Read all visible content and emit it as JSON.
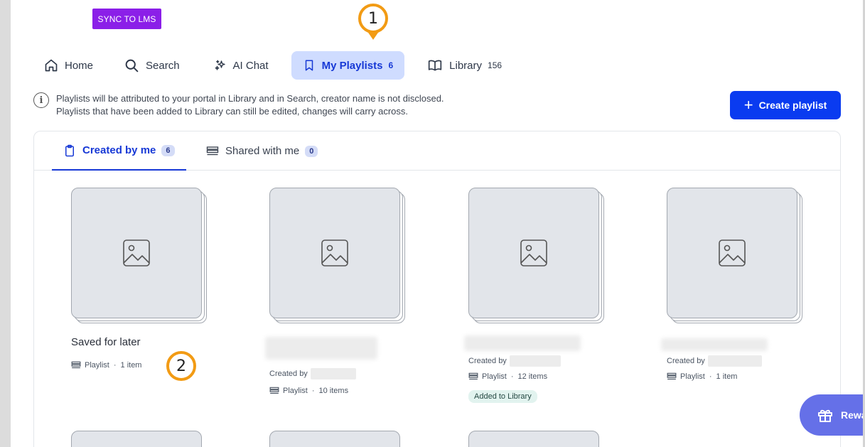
{
  "sync_label": "SYNC TO LMS",
  "markers": [
    "1",
    "2"
  ],
  "nav": [
    {
      "label": "Home",
      "icon": "home-icon"
    },
    {
      "label": "Search",
      "icon": "search-icon"
    },
    {
      "label": "AI Chat",
      "icon": "sparkle-icon"
    },
    {
      "label": "My Playlists",
      "icon": "bookmark-icon",
      "count": "6",
      "active": true
    },
    {
      "label": "Library",
      "icon": "book-icon",
      "count": "156"
    }
  ],
  "info": {
    "line1": "Playlists will be attributed to your portal in Library and in Search, creator name is not disclosed.",
    "line2": "Playlists that have been added to Library can still be edited, changes will carry across."
  },
  "create_label": "Create playlist",
  "tabs": [
    {
      "label": "Created by me",
      "count": "6"
    },
    {
      "label": "Shared with me",
      "count": "0"
    }
  ],
  "cards": [
    {
      "title": "Saved for later",
      "type": "Playlist",
      "items": "1 item"
    },
    {
      "created_by": "Created by",
      "type": "Playlist",
      "items": "10 items"
    },
    {
      "created_by": "Created by",
      "type": "Playlist",
      "items": "12 items",
      "badge": "Added to Library"
    },
    {
      "created_by": "Created by",
      "type": "Playlist",
      "items": "1 item"
    }
  ],
  "meta_separator": "·",
  "rewards_label": "Rewa",
  "colors": {
    "accent": "#1739d6",
    "primary_button": "#0a3bf0",
    "sync": "#8b1fe8",
    "marker": "#f29b14",
    "rewards": "#6570e8"
  }
}
